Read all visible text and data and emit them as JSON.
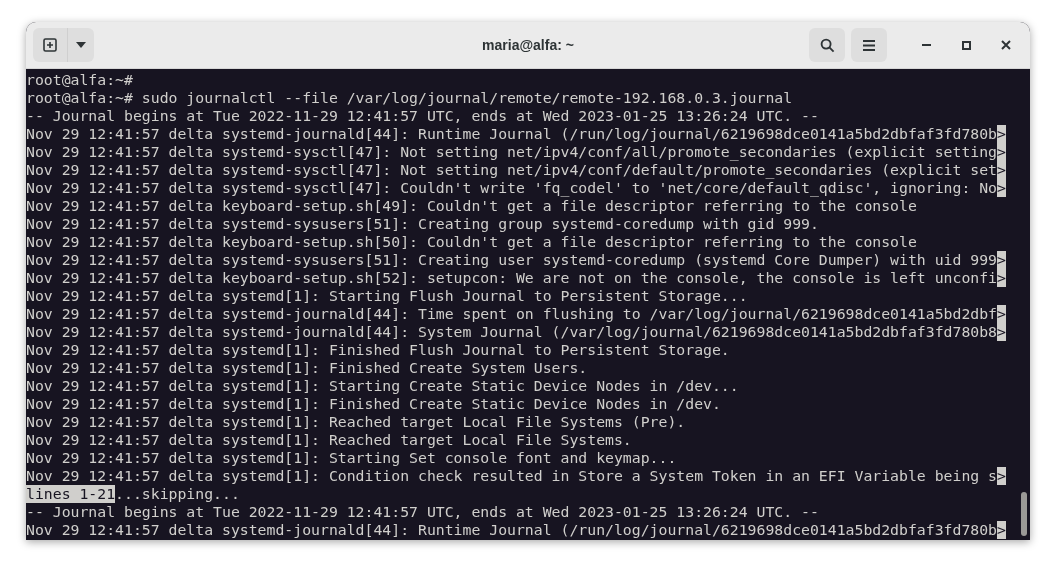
{
  "window": {
    "title": "maria@alfa: ~"
  },
  "terminal": {
    "lines": [
      {
        "kind": "text",
        "text": "root@alfa:~#"
      },
      {
        "kind": "text",
        "text": "root@alfa:~# sudo journalctl --file /var/log/journal/remote/remote-192.168.0.3.journal"
      },
      {
        "kind": "text",
        "text": "-- Journal begins at Tue 2022-11-29 12:41:57 UTC, ends at Wed 2023-01-25 13:26:24 UTC. --"
      },
      {
        "kind": "text",
        "text": "Nov 29 12:41:57 delta systemd-journald[44]: Runtime Journal (/run/log/journal/6219698dce0141a5bd2dbfaf3fd780b",
        "marker": ">"
      },
      {
        "kind": "text",
        "text": "Nov 29 12:41:57 delta systemd-sysctl[47]: Not setting net/ipv4/conf/all/promote_secondaries (explicit setting",
        "marker": ">"
      },
      {
        "kind": "text",
        "text": "Nov 29 12:41:57 delta systemd-sysctl[47]: Not setting net/ipv4/conf/default/promote_secondaries (explicit set",
        "marker": ">"
      },
      {
        "kind": "text",
        "text": "Nov 29 12:41:57 delta systemd-sysctl[47]: Couldn't write 'fq_codel' to 'net/core/default_qdisc', ignoring: No",
        "marker": ">"
      },
      {
        "kind": "text",
        "text": "Nov 29 12:41:57 delta keyboard-setup.sh[49]: Couldn't get a file descriptor referring to the console"
      },
      {
        "kind": "text",
        "text": "Nov 29 12:41:57 delta systemd-sysusers[51]: Creating group systemd-coredump with gid 999."
      },
      {
        "kind": "text",
        "text": "Nov 29 12:41:57 delta keyboard-setup.sh[50]: Couldn't get a file descriptor referring to the console"
      },
      {
        "kind": "text",
        "text": "Nov 29 12:41:57 delta systemd-sysusers[51]: Creating user systemd-coredump (systemd Core Dumper) with uid 999",
        "marker": ">"
      },
      {
        "kind": "text",
        "text": "Nov 29 12:41:57 delta keyboard-setup.sh[52]: setupcon: We are not on the console, the console is left unconfi",
        "marker": ">"
      },
      {
        "kind": "text",
        "text": "Nov 29 12:41:57 delta systemd[1]: Starting Flush Journal to Persistent Storage..."
      },
      {
        "kind": "text",
        "text": "Nov 29 12:41:57 delta systemd-journald[44]: Time spent on flushing to /var/log/journal/6219698dce0141a5bd2dbf",
        "marker": ">"
      },
      {
        "kind": "text",
        "text": "Nov 29 12:41:57 delta systemd-journald[44]: System Journal (/var/log/journal/6219698dce0141a5bd2dbfaf3fd780b8",
        "marker": ">"
      },
      {
        "kind": "text",
        "text": "Nov 29 12:41:57 delta systemd[1]: Finished Flush Journal to Persistent Storage."
      },
      {
        "kind": "text",
        "text": "Nov 29 12:41:57 delta systemd[1]: Finished Create System Users."
      },
      {
        "kind": "text",
        "text": "Nov 29 12:41:57 delta systemd[1]: Starting Create Static Device Nodes in /dev..."
      },
      {
        "kind": "text",
        "text": "Nov 29 12:41:57 delta systemd[1]: Finished Create Static Device Nodes in /dev."
      },
      {
        "kind": "text",
        "text": "Nov 29 12:41:57 delta systemd[1]: Reached target Local File Systems (Pre)."
      },
      {
        "kind": "text",
        "text": "Nov 29 12:41:57 delta systemd[1]: Reached target Local File Systems."
      },
      {
        "kind": "text",
        "text": "Nov 29 12:41:57 delta systemd[1]: Starting Set console font and keymap..."
      },
      {
        "kind": "text",
        "text": "Nov 29 12:41:57 delta systemd[1]: Condition check resulted in Store a System Token in an EFI Variable being s",
        "marker": ">"
      },
      {
        "kind": "pager",
        "highlight": "lines 1-21",
        "text": "...skipping..."
      },
      {
        "kind": "text",
        "text": "-- Journal begins at Tue 2022-11-29 12:41:57 UTC, ends at Wed 2023-01-25 13:26:24 UTC. --"
      },
      {
        "kind": "text",
        "text": "Nov 29 12:41:57 delta systemd-journald[44]: Runtime Journal (/run/log/journal/6219698dce0141a5bd2dbfaf3fd780b",
        "marker": ">"
      }
    ]
  }
}
